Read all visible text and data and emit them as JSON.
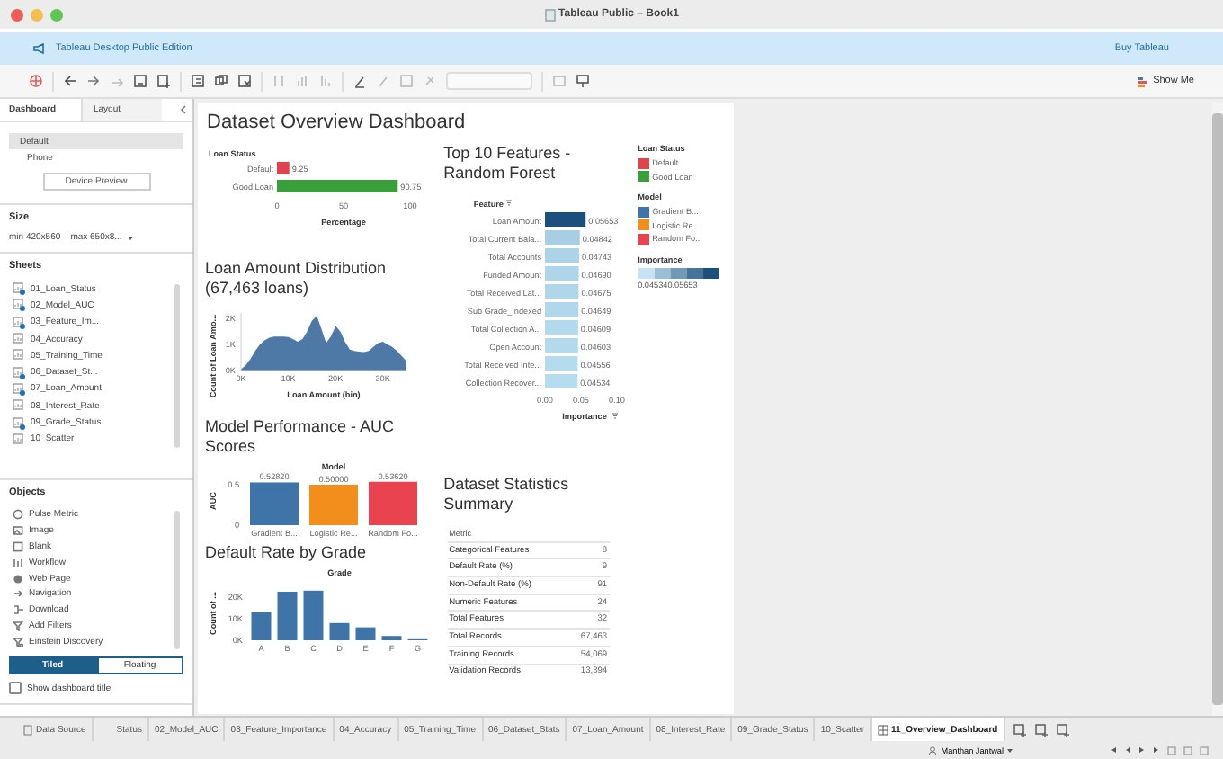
{
  "window": {
    "title": "Tableau Public – Book1"
  },
  "banner": {
    "edition": "Tableau Desktop Public Edition",
    "link": "Buy Tableau"
  },
  "toolbar": {
    "show_me": "Show Me"
  },
  "side_panel": {
    "tabs": [
      {
        "label": "Dashboard",
        "selected": true
      },
      {
        "label": "Layout",
        "selected": false
      }
    ],
    "devices": [
      {
        "label": "Default",
        "selected": true
      },
      {
        "label": "Phone",
        "selected": false
      }
    ],
    "device_preview": "Device Preview",
    "size": {
      "heading": "Size",
      "value": "min 420x560 – max 650x8..."
    },
    "sheets": {
      "heading": "Sheets",
      "items": [
        {
          "label": "01_Loan_Status",
          "in_use": true
        },
        {
          "label": "02_Model_AUC",
          "in_use": true
        },
        {
          "label": "03_Feature_Im...",
          "in_use": true
        },
        {
          "label": "04_Accuracy",
          "in_use": false
        },
        {
          "label": "05_Training_Time",
          "in_use": false
        },
        {
          "label": "06_Dataset_St...",
          "in_use": true
        },
        {
          "label": "07_Loan_Amount",
          "in_use": true
        },
        {
          "label": "08_Interest_Rate",
          "in_use": false
        },
        {
          "label": "09_Grade_Status",
          "in_use": true
        },
        {
          "label": "10_Scatter",
          "in_use": false
        }
      ]
    },
    "objects": {
      "heading": "Objects",
      "items": [
        {
          "label": "Pulse Metric",
          "kind": "metric"
        },
        {
          "label": "Image",
          "kind": "image"
        },
        {
          "label": "Blank",
          "kind": "blank"
        },
        {
          "label": "Workflow",
          "kind": "workflow"
        },
        {
          "label": "Web Page",
          "kind": "web"
        },
        {
          "label": "Navigation",
          "kind": "navigation"
        },
        {
          "label": "Download",
          "kind": "download"
        },
        {
          "label": "Add Filters",
          "kind": "filter"
        },
        {
          "label": "Einstein Discovery",
          "kind": "discovery"
        }
      ]
    },
    "layout_toggle": [
      {
        "label": "Tiled",
        "selected": true
      },
      {
        "label": "Floating",
        "selected": false
      }
    ],
    "show_title": {
      "label": "Show dashboard title",
      "checked": false
    }
  },
  "dashboard": {
    "title": "Dataset Overview Dashboard",
    "loan_status": {
      "chart_data": {
        "type": "bar",
        "orientation": "horizontal",
        "ylabel": "Loan Status",
        "xlabel": "Percentage",
        "categories": [
          "Default",
          "Good Loan"
        ],
        "series": [
          {
            "color": "#e0434d",
            "values": [
              9.25,
              null
            ]
          },
          {
            "color": "#3a9e3a",
            "values": [
              null,
              90.75
            ]
          }
        ],
        "xlim": [
          0,
          100
        ],
        "xticks": [
          0,
          50,
          100
        ],
        "value_labels": [
          "9.25",
          "90.75"
        ]
      }
    },
    "loan_amount": {
      "title": "Loan Amount Distribution (67,463 loans)",
      "chart_data": {
        "type": "area",
        "xlabel": "Loan Amount (bin)",
        "ylabel": "Count of Loan Amo...",
        "x": [
          0,
          1,
          2,
          3,
          4,
          5,
          6,
          7,
          8,
          9,
          10,
          11,
          12,
          13,
          14,
          15,
          16,
          17,
          18,
          19,
          20,
          21,
          22,
          23,
          24,
          25,
          26,
          27,
          28,
          29,
          30,
          31,
          32,
          33,
          34,
          35
        ],
        "series": [
          {
            "color": "#4e79a7",
            "values": [
              50,
              200,
              450,
              750,
              1000,
              1150,
              1250,
              1300,
              1300,
              1300,
              1280,
              1200,
              1100,
              1200,
              1500,
              1900,
              2100,
              1600,
              1050,
              1300,
              1700,
              1500,
              1100,
              800,
              750,
              720,
              700,
              750,
              900,
              1050,
              1100,
              1000,
              900,
              750,
              550,
              350
            ]
          }
        ],
        "xlim": [
          0,
          35
        ],
        "ylim": [
          0,
          2200
        ],
        "xticks": [
          {
            "value": 0,
            "label": "0K"
          },
          {
            "value": 10,
            "label": "10K"
          },
          {
            "value": 20,
            "label": "20K"
          },
          {
            "value": 30,
            "label": "30K"
          }
        ],
        "yticks": [
          {
            "value": 0,
            "label": "0K"
          },
          {
            "value": 1000,
            "label": "1K"
          },
          {
            "value": 2000,
            "label": "2K"
          }
        ]
      }
    },
    "auc": {
      "title": "Model Performance - AUC Scores",
      "chart_data": {
        "type": "bar",
        "orientation": "vertical",
        "xlabel": "Model",
        "ylabel": "AUC",
        "categories": [
          "Gradient B...",
          "Logistic Re...",
          "Random Fo..."
        ],
        "series": [
          {
            "color": "#3f74a8",
            "values": [
              0.5282,
              null,
              null
            ]
          },
          {
            "color": "#f28e1c",
            "values": [
              null,
              0.5,
              null
            ]
          },
          {
            "color": "#e8434f",
            "values": [
              null,
              null,
              0.5362
            ]
          }
        ],
        "ylim": [
          0,
          0.6
        ],
        "yticks": [
          0,
          0.5
        ],
        "value_labels": [
          "0.52820",
          "0.50000",
          "0.53620"
        ]
      }
    },
    "grade": {
      "title": "Default Rate by Grade",
      "chart_data": {
        "type": "bar",
        "orientation": "vertical",
        "xlabel": "Grade",
        "ylabel": "Count of ...",
        "categories": [
          "A",
          "B",
          "C",
          "D",
          "E",
          "F",
          "G"
        ],
        "series": [
          {
            "color": "#3f74a8",
            "values": [
              13000,
              22500,
              23000,
              8000,
              6000,
              2000,
              500
            ]
          }
        ],
        "ylim": [
          0,
          25000
        ],
        "yticks": [
          {
            "value": 0,
            "label": "0K"
          },
          {
            "value": 10000,
            "label": "10K"
          },
          {
            "value": 20000,
            "label": "20K"
          }
        ]
      }
    },
    "features": {
      "title": "Top 10 Features - Random Forest",
      "chart_data": {
        "type": "bar",
        "orientation": "horizontal",
        "ylabel": "Feature",
        "xlabel": "Importance",
        "categories": [
          "Loan Amount",
          "Total Current Bala...",
          "Total Accounts",
          "Funded Amount",
          "Total Received Lat...",
          "Sub Grade_Indexed",
          "Total Collection A...",
          "Open Account",
          "Total Received Inte...",
          "Collection Recover..."
        ],
        "series": [
          {
            "values": [
              0.05653,
              0.04842,
              0.04743,
              0.0469,
              0.04675,
              0.04649,
              0.04609,
              0.04603,
              0.04556,
              0.04534
            ]
          }
        ],
        "xlim": [
          0,
          0.1
        ],
        "xticks": [
          {
            "value": 0,
            "label": "0.00"
          },
          {
            "value": 0.05,
            "label": "0.05"
          },
          {
            "value": 0.1,
            "label": "0.10"
          }
        ],
        "value_labels": [
          "0.05653",
          "0.04842",
          "0.04743",
          "0.04690",
          "0.04675",
          "0.04649",
          "0.04609",
          "0.04603",
          "0.04556",
          "0.04534"
        ]
      }
    },
    "stats": {
      "title": "Dataset Statistics Summary",
      "header": "Metric",
      "rows": [
        {
          "metric": "Categorical Features",
          "value": "8"
        },
        {
          "metric": "Default Rate (%)",
          "value": "9"
        },
        {
          "metric": "Non-Default Rate (%)",
          "value": "91"
        },
        {
          "metric": "Numeric Features",
          "value": "24"
        },
        {
          "metric": "Total Features",
          "value": "32"
        },
        {
          "metric": "Total Records",
          "value": "67,463"
        },
        {
          "metric": "Training Records",
          "value": "54,069"
        },
        {
          "metric": "Validation Records",
          "value": "13,394"
        }
      ]
    },
    "legends": [
      {
        "title": "Loan Status",
        "kind": "swatches",
        "items": [
          {
            "label": "Default",
            "color": "#e0434d"
          },
          {
            "label": "Good Loan",
            "color": "#3a9e3a"
          }
        ]
      },
      {
        "title": "Model",
        "kind": "swatches",
        "items": [
          {
            "label": "Gradient B...",
            "color": "#3f74a8"
          },
          {
            "label": "Logistic Re...",
            "color": "#f28e1c"
          },
          {
            "label": "Random Fo...",
            "color": "#e8434f"
          }
        ]
      },
      {
        "title": "Importance",
        "kind": "gradient",
        "min": "0.04534",
        "max": "0.05653",
        "color": "#1c4f7c"
      }
    ]
  },
  "sheet_tabs": [
    {
      "label": "Data Source",
      "kind": "source",
      "selected": false
    },
    {
      "label": "Status",
      "kind": "sheet",
      "selected": false
    },
    {
      "label": "02_Model_AUC",
      "kind": "sheet",
      "selected": false
    },
    {
      "label": "03_Feature_Importance",
      "kind": "sheet",
      "selected": false
    },
    {
      "label": "04_Accuracy",
      "kind": "sheet",
      "selected": false
    },
    {
      "label": "05_Training_Time",
      "kind": "sheet",
      "selected": false
    },
    {
      "label": "06_Dataset_Stats",
      "kind": "sheet",
      "selected": false
    },
    {
      "label": "07_Loan_Amount",
      "kind": "sheet",
      "selected": false
    },
    {
      "label": "08_Interest_Rate",
      "kind": "sheet",
      "selected": false
    },
    {
      "label": "09_Grade_Status",
      "kind": "sheet",
      "selected": false
    },
    {
      "label": "10_Scatter",
      "kind": "sheet",
      "selected": false
    },
    {
      "label": "11_Overview_Dashboard",
      "kind": "dashboard",
      "selected": true
    }
  ],
  "status_bar": {
    "user": "Manthan Jantwal"
  }
}
